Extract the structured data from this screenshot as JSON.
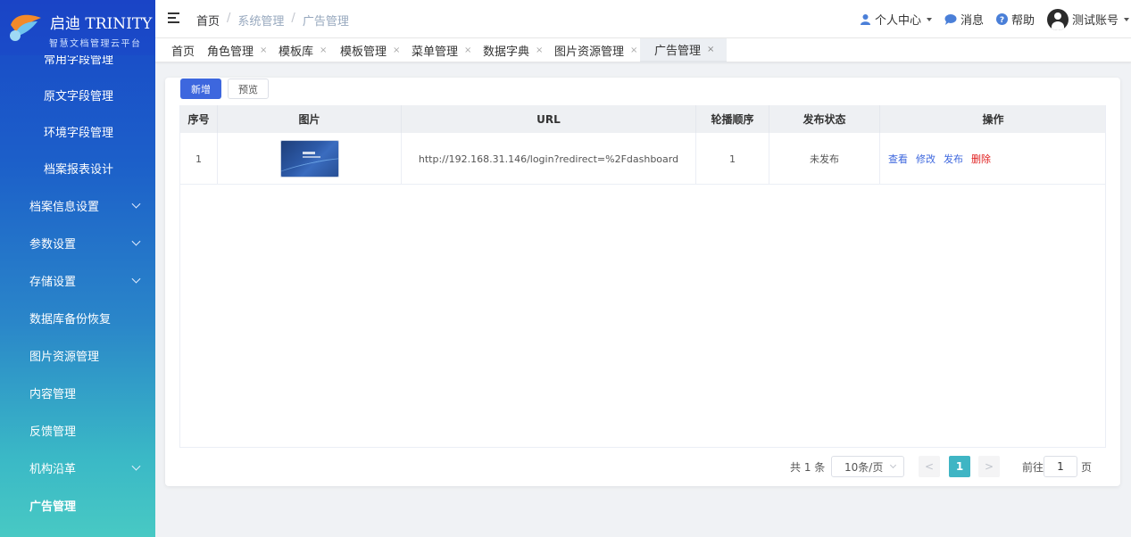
{
  "app": {
    "logo_title": "启迪 TRINITY",
    "logo_subtitle": "智慧文档管理云平台"
  },
  "sidebar": {
    "items": [
      {
        "label": "常用字段管理",
        "level": "sub",
        "expandable": false
      },
      {
        "label": "原文字段管理",
        "level": "sub",
        "expandable": false
      },
      {
        "label": "环境字段管理",
        "level": "sub",
        "expandable": false
      },
      {
        "label": "档案报表设计",
        "level": "sub",
        "expandable": false
      },
      {
        "label": "档案信息设置",
        "level": "top",
        "expandable": true
      },
      {
        "label": "参数设置",
        "level": "top",
        "expandable": true
      },
      {
        "label": "存储设置",
        "level": "top",
        "expandable": true
      },
      {
        "label": "数据库备份恢复",
        "level": "top",
        "expandable": false
      },
      {
        "label": "图片资源管理",
        "level": "top",
        "expandable": false
      },
      {
        "label": "内容管理",
        "level": "top",
        "expandable": false
      },
      {
        "label": "反馈管理",
        "level": "top",
        "expandable": false
      },
      {
        "label": "机构沿革",
        "level": "top",
        "expandable": true
      },
      {
        "label": "广告管理",
        "level": "top",
        "expandable": false,
        "active": true
      }
    ]
  },
  "header": {
    "breadcrumb": [
      "首页",
      "系统管理",
      "广告管理"
    ],
    "breadcrumb_sep": "/",
    "user_center": "个人中心",
    "messages": "消息",
    "help": "帮助",
    "account": "测试账号"
  },
  "tabs": [
    {
      "label": "首页",
      "closable": false
    },
    {
      "label": "角色管理",
      "closable": true
    },
    {
      "label": "模板库",
      "closable": true
    },
    {
      "label": "模板管理",
      "closable": true
    },
    {
      "label": "菜单管理",
      "closable": true
    },
    {
      "label": "数据字典",
      "closable": true
    },
    {
      "label": "图片资源管理",
      "closable": true
    },
    {
      "label": "广告管理",
      "closable": true,
      "active": true
    }
  ],
  "tab_close": "×",
  "toolbar": {
    "add_label": "新增",
    "preview_label": "预览"
  },
  "table": {
    "columns": [
      "序号",
      "图片",
      "URL",
      "轮播顺序",
      "发布状态",
      "操作"
    ],
    "rows": [
      {
        "index": "1",
        "url": "http://192.168.31.146/login?redirect=%2Fdashboard",
        "order": "1",
        "status": "未发布",
        "ops": [
          "查看",
          "修改",
          "发布",
          "删除"
        ]
      }
    ]
  },
  "pagination": {
    "total": "共 1 条",
    "page_size": "10条/页",
    "prev": "<",
    "current": "1",
    "next": ">",
    "jump_label": "前往",
    "jump_value": "1",
    "jump_unit": "页"
  },
  "colors": {
    "primary": "#3d67de",
    "danger": "#e02020",
    "page_active": "#3fb5c4"
  }
}
